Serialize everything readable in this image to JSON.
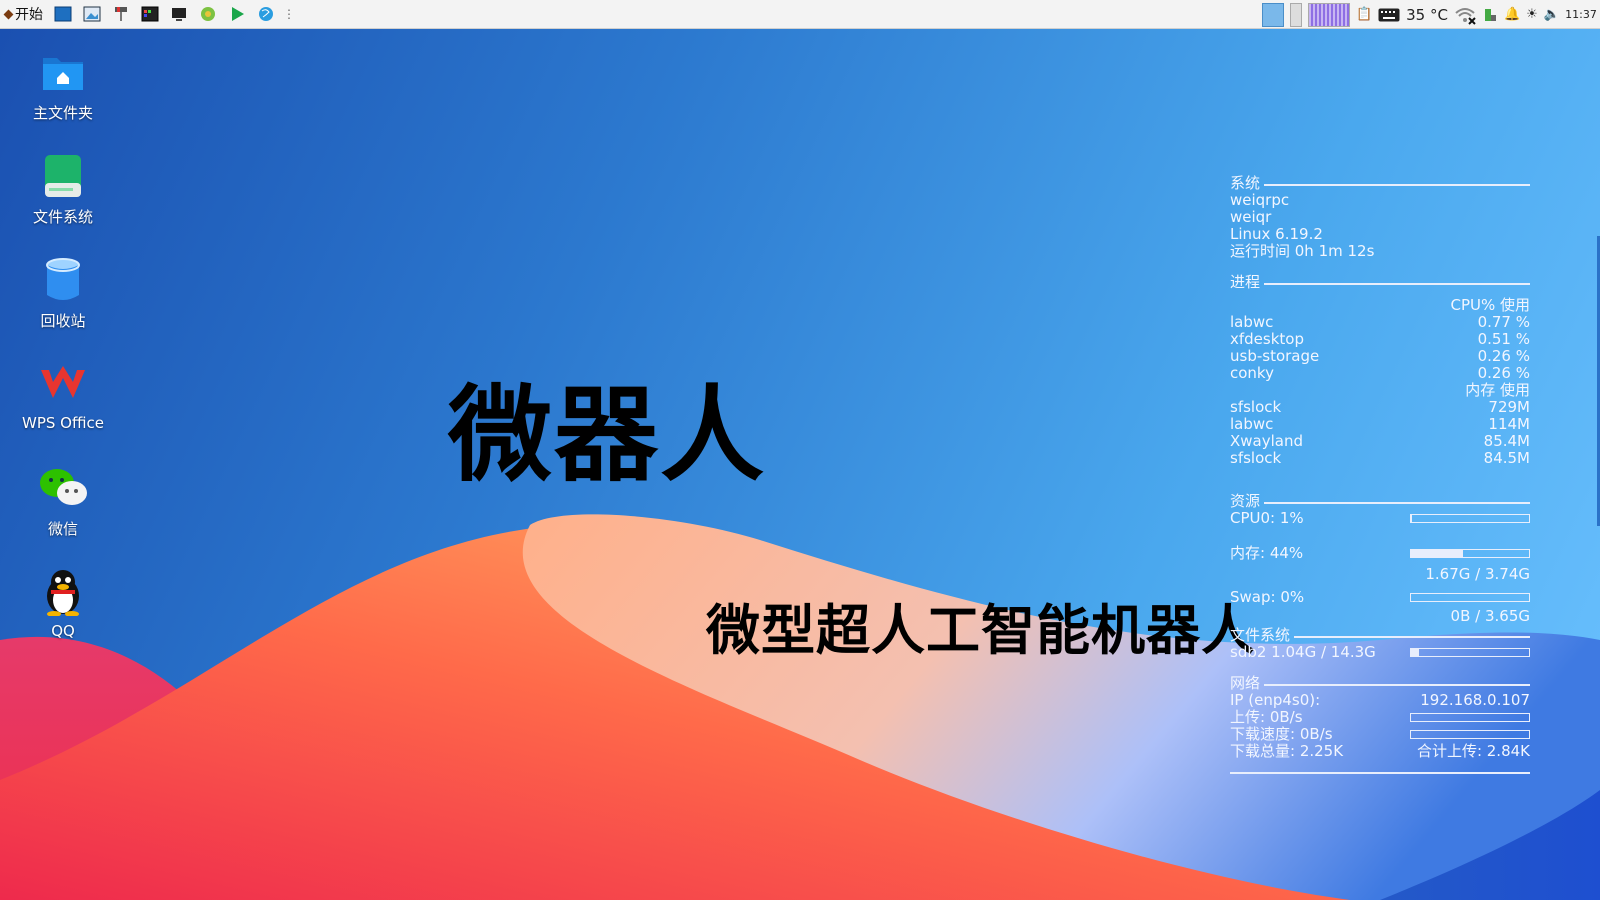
{
  "taskbar": {
    "start_label": "开始",
    "temperature": "35 °C",
    "clock": "11:37"
  },
  "desktop_icons": [
    {
      "label": "主文件夹"
    },
    {
      "label": "文件系统"
    },
    {
      "label": "回收站"
    },
    {
      "label": "WPS Office"
    },
    {
      "label": "微信"
    },
    {
      "label": "QQ"
    }
  ],
  "wallpaper": {
    "title": "微器人",
    "subtitle": "微型超人工智能机器人"
  },
  "conky": {
    "system": {
      "header": "系统",
      "hostname": "weiqrpc",
      "user": "weiqr",
      "kernel": "Linux 6.19.2",
      "uptime": "运行时间 0h 1m 12s"
    },
    "processes": {
      "header": "进程",
      "cpu_header": "CPU% 使用",
      "cpu_rows": [
        {
          "name": "labwc",
          "value": "0.77 %"
        },
        {
          "name": "xfdesktop",
          "value": "0.51 %"
        },
        {
          "name": "usb-storage",
          "value": "0.26 %"
        },
        {
          "name": "conky",
          "value": "0.26 %"
        }
      ],
      "mem_header": "内存  使用",
      "mem_rows": [
        {
          "name": "sfslock",
          "value": "729M"
        },
        {
          "name": "labwc",
          "value": "114M"
        },
        {
          "name": "Xwayland",
          "value": "85.4M"
        },
        {
          "name": "sfslock",
          "value": "84.5M"
        }
      ]
    },
    "resources": {
      "header": "资源",
      "cpu_label": "CPU0: 1%",
      "cpu_percent": 1,
      "mem_label": "内存: 44%",
      "mem_percent": 44,
      "mem_detail": "1.67G / 3.74G",
      "swap_label": "Swap: 0%",
      "swap_percent": 0,
      "swap_detail": "0B / 3.65G"
    },
    "filesystem": {
      "header": "文件系统",
      "sdb2_label": "sdb2 1.04G / 14.3G",
      "sdb2_percent": 7
    },
    "network": {
      "header": "网络",
      "ip_label": "IP (enp4s0):",
      "ip_value": "192.168.0.107",
      "upload_label": "上传: 0B/s",
      "download_label": "下载速度: 0B/s",
      "download_total": "下载总量: 2.25K",
      "upload_total": "合计上传: 2.84K"
    }
  },
  "colors": {
    "background_blue": "#2c79cf",
    "wave_orange": "#ff8f5a",
    "wave_red": "#f0304a",
    "wave_lavender": "#aebdf6",
    "temp_green": "#20a020"
  }
}
